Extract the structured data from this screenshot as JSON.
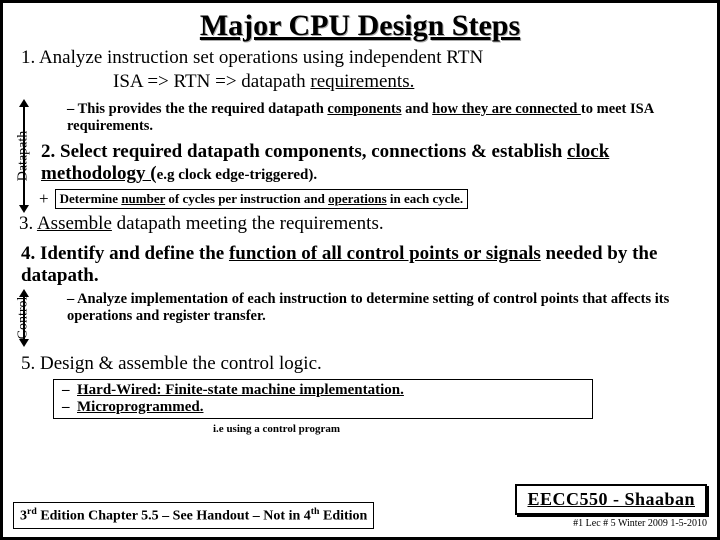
{
  "title": "Major CPU Design Steps",
  "step1": "1. Analyze instruction set  operations using independent RTN",
  "isa_line_a": "ISA => RTN  =>  datapath ",
  "isa_line_b": "requirements.",
  "labels": {
    "datapath": "Datapath",
    "control": "Control"
  },
  "sub1_a": "This provides the the required datapath ",
  "sub1_b": "components",
  "sub1_c": " and ",
  "sub1_d": "how they are connected ",
  "sub1_e": "to meet ISA requirements.",
  "step2_a": "2. Select required datapath components, connections & establish ",
  "step2_b": "clock methodology (",
  "step2_c": "e.g clock edge-triggered).",
  "plusbox_a": "Determine ",
  "plusbox_b": "number",
  "plusbox_c": " of cycles per instruction and ",
  "plusbox_d": "operations",
  "plusbox_e": " in each cycle.",
  "step3_a": "3. ",
  "step3_b": "Assemble",
  "step3_c": " datapath meeting the requirements.",
  "step4_a": "4. Identify and define the ",
  "step4_b": "function of all control points or signals",
  "step4_c": " needed by the datapath.",
  "sub4": "Analyze implementation of each instruction to determine setting of control points that affects its operations and register transfer.",
  "step5": "5. Design & assemble the control logic.",
  "hw_a": "Hard-Wired:  Finite-state machine implementation.",
  "hw_b": "Microprogrammed.",
  "ie": "i.e using a control program",
  "handout_a": "3",
  "handout_b": " Edition Chapter 5.5 – See Handout – Not in 4",
  "handout_c": " Edition",
  "eecc": "EECC550 - Shaaban",
  "footline": "#1   Lec # 5  Winter 2009  1-5-2010"
}
